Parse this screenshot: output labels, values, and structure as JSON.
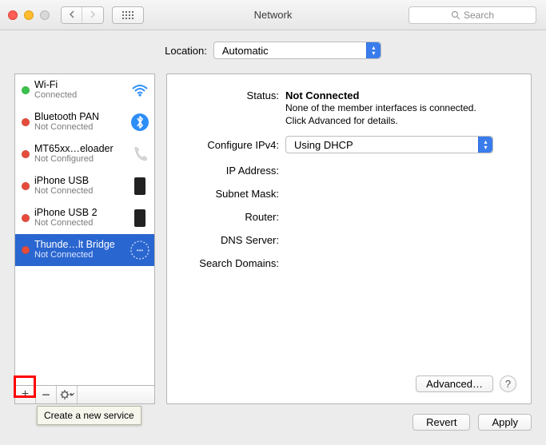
{
  "window": {
    "title": "Network"
  },
  "search": {
    "placeholder": "Search"
  },
  "location": {
    "label": "Location:",
    "value": "Automatic"
  },
  "services": [
    {
      "name": "Wi-Fi",
      "status": "Connected",
      "dot": "green",
      "icon": "wifi"
    },
    {
      "name": "Bluetooth PAN",
      "status": "Not Connected",
      "dot": "red",
      "icon": "bluetooth"
    },
    {
      "name": "MT65xx…eloader",
      "status": "Not Configured",
      "dot": "red",
      "icon": "serial"
    },
    {
      "name": "iPhone USB",
      "status": "Not Connected",
      "dot": "red",
      "icon": "phone"
    },
    {
      "name": "iPhone USB 2",
      "status": "Not Connected",
      "dot": "red",
      "icon": "phone"
    },
    {
      "name": "Thunde…lt Bridge",
      "status": "Not Connected",
      "dot": "red",
      "icon": "thunderbolt",
      "selected": true
    }
  ],
  "detail": {
    "status_label": "Status:",
    "status_value": "Not Connected",
    "status_sub1": "None of the member interfaces is connected.",
    "status_sub2": "Click Advanced for details.",
    "configure_label": "Configure IPv4:",
    "configure_value": "Using DHCP",
    "ip_label": "IP Address:",
    "subnet_label": "Subnet Mask:",
    "router_label": "Router:",
    "dns_label": "DNS Server:",
    "search_label": "Search Domains:",
    "advanced": "Advanced…",
    "help": "?"
  },
  "footer": {
    "revert": "Revert",
    "apply": "Apply"
  },
  "tooltip": {
    "add": "Create a new service"
  },
  "tool_labels": {
    "add": "+",
    "remove": "−",
    "gear": "✻▾"
  }
}
